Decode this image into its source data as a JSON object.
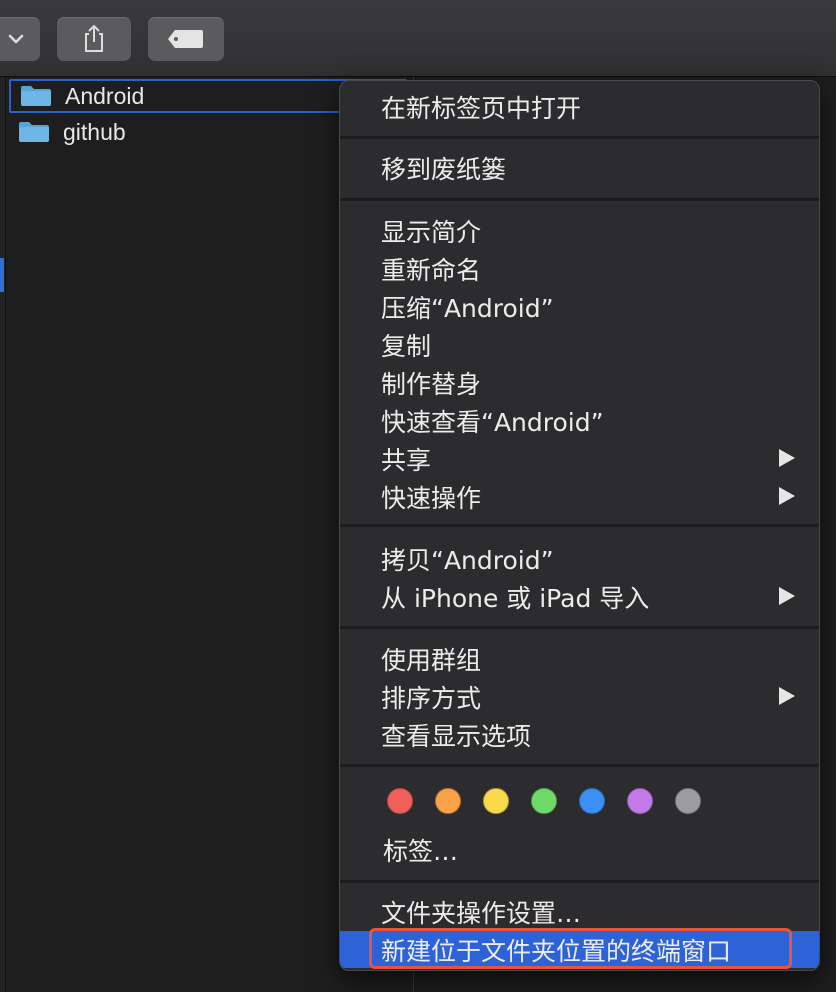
{
  "toolbar": {
    "buttons": [
      {
        "icon": "chevron-down-icon"
      },
      {
        "icon": "share-icon"
      },
      {
        "icon": "tag-icon"
      }
    ]
  },
  "files": [
    {
      "name": "Android",
      "icon": "folder-icon",
      "selected": true
    },
    {
      "name": "github",
      "icon": "folder-icon",
      "selected": false
    }
  ],
  "context_menu": {
    "groups": [
      [
        {
          "label": "在新标签页中打开"
        }
      ],
      [
        {
          "label": "移到废纸篓"
        }
      ],
      [
        {
          "label": "显示简介"
        },
        {
          "label": "重新命名"
        },
        {
          "label": "压缩“Android”"
        },
        {
          "label": "复制"
        },
        {
          "label": "制作替身"
        },
        {
          "label": "快速查看“Android”"
        },
        {
          "label": "共享",
          "submenu": true
        },
        {
          "label": "快速操作",
          "submenu": true
        }
      ],
      [
        {
          "label": "拷贝“Android”"
        },
        {
          "label": "从 iPhone 或 iPad 导入",
          "submenu": true
        }
      ],
      [
        {
          "label": "使用群组"
        },
        {
          "label": "排序方式",
          "submenu": true
        },
        {
          "label": "查看显示选项"
        }
      ]
    ],
    "tag_colors": [
      "#f0605a",
      "#f8a24a",
      "#fad84c",
      "#6fda68",
      "#3b8ff5",
      "#c479e8",
      "#9d9d9f"
    ],
    "tag_color_names": [
      "red",
      "orange",
      "yellow",
      "green",
      "blue",
      "purple",
      "gray"
    ],
    "tags_label": "标签…",
    "folder_actions_label": "文件夹操作设置…",
    "new_terminal_label": "新建位于文件夹位置的终端窗口"
  },
  "colors": {
    "selection": "#2d63d6",
    "highlight_outline": "#e8543e",
    "menu_background": "#2c2c2e"
  }
}
